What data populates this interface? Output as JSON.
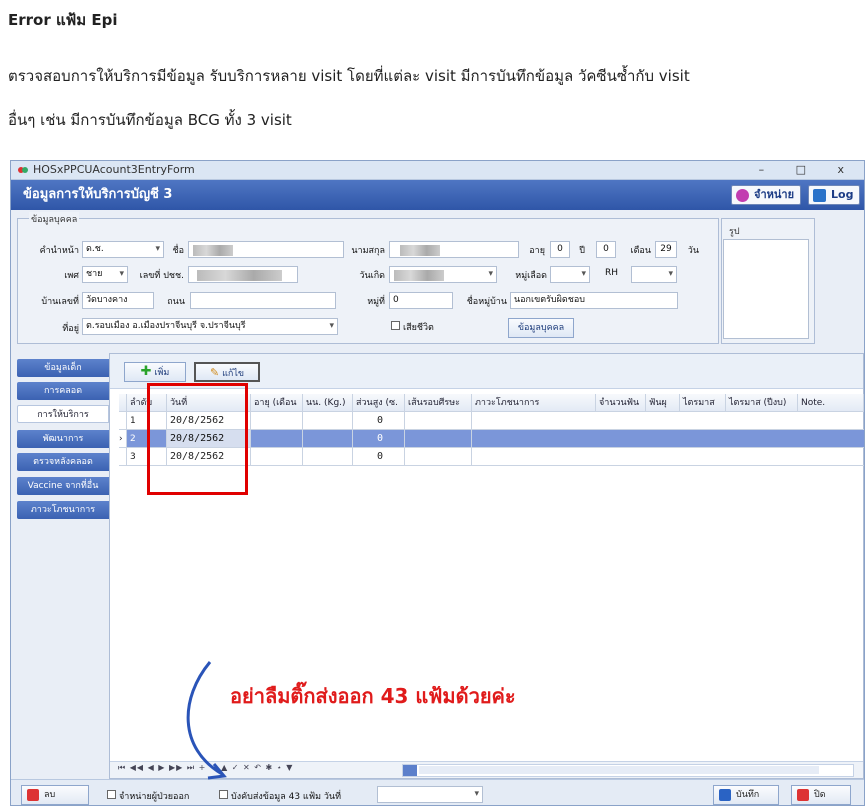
{
  "doc": {
    "title": "Error แฟ้ม Epi",
    "line1": "ตรวจสอบการให้บริการมีข้อมูล รับบริการหลาย visit  โดยที่แต่ละ visit มีการบันทึกข้อมูล วัคซีนซ้ำกับ visit",
    "line2": "อื่นๆ เช่น มีการบันทึกข้อมูล BCG ทั้ง 3  visit",
    "note": "อย่าลืมติ๊กส่งออก 43 แฟ้มด้วยค่ะ"
  },
  "window": {
    "title": "HOSxPPCUAcount3EntryForm",
    "controls": "– □ x",
    "header": "ข้อมูลการให้บริการบัญชี 3",
    "discharge_btn": "จำหน่าย",
    "log_btn": "Log"
  },
  "person": {
    "group_label": "ข้อมูลบุคคล",
    "photo_label": "รูป",
    "prefix_label": "คำนำหน้า",
    "prefix_value": "ด.ช.",
    "name_label": "ชื่อ",
    "surname_label": "นามสกุล",
    "age_label": "อายุ",
    "age_y": "0",
    "year_label": "ปี",
    "age_m": "0",
    "month_label": "เดือน",
    "age_d": "29",
    "day_label": "วัน",
    "sex_label": "เพศ",
    "sex_value": "ชาย",
    "cid_label": "เลขที่ ปชช.",
    "dob_label": "วันเกิด",
    "blood_label": "หมู่เลือด",
    "rh_label": "RH",
    "house_label": "บ้านเลขที่",
    "house_value": "วัดบางคาง",
    "road_label": "ถนน",
    "moo_label": "หมู่ที่",
    "moo_value": "0",
    "village_label": "ชื่อหมู่บ้าน",
    "village_value": "นอกเขตรับผิดชอบ",
    "address_label": "ที่อยู่",
    "address_value": "ต.รอบเมือง อ.เมืองปราจีนบุรี จ.ปราจีนบุรี",
    "death_label": "เสียชีวิต",
    "person_btn": "ข้อมูลบุคคล"
  },
  "sidebar": {
    "items": [
      {
        "label": "ข้อมูลเด็ก"
      },
      {
        "label": "การคลอด"
      },
      {
        "label": "การให้บริการ"
      },
      {
        "label": "พัฒนาการ"
      },
      {
        "label": "ตรวจหลังคลอด"
      },
      {
        "label": "Vaccine จากที่อื่น"
      },
      {
        "label": "ภาวะโภชนาการ"
      }
    ]
  },
  "toolbar": {
    "add": "เพิ่ม",
    "edit": "แก้ไข"
  },
  "grid": {
    "columns": [
      "ลำดับ",
      "วันที่",
      "อายุ (เดือน",
      "นน. (Kg.)",
      "ส่วนสูง (ซ.",
      "เส้นรอบศีรษะ",
      "ภาวะโภชนาการ",
      "จำนวนฟัน",
      "ฟันผุ",
      "ไตรมาส",
      "ไตรมาส (ปีงบ)",
      "Note."
    ],
    "rows": [
      {
        "no": "1",
        "date": "20/8/2562",
        "height": "0"
      },
      {
        "no": "2",
        "date": "20/8/2562",
        "height": "0"
      },
      {
        "no": "3",
        "date": "20/8/2562",
        "height": "0"
      }
    ],
    "nav": "⏮ ◀◀ ◀ ▶ ▶▶ ⏭ + − ▲ ✓ ✕ ↶ ✱ ⋆ ▼"
  },
  "footer": {
    "delete": "ลบ",
    "discharge_chk": "จำหน่ายผู้ป่วยออก",
    "export_chk": "บังคับส่งข้อมูล 43 แฟ้ม วันที่",
    "save": "บันทึก",
    "close": "ปิด"
  }
}
